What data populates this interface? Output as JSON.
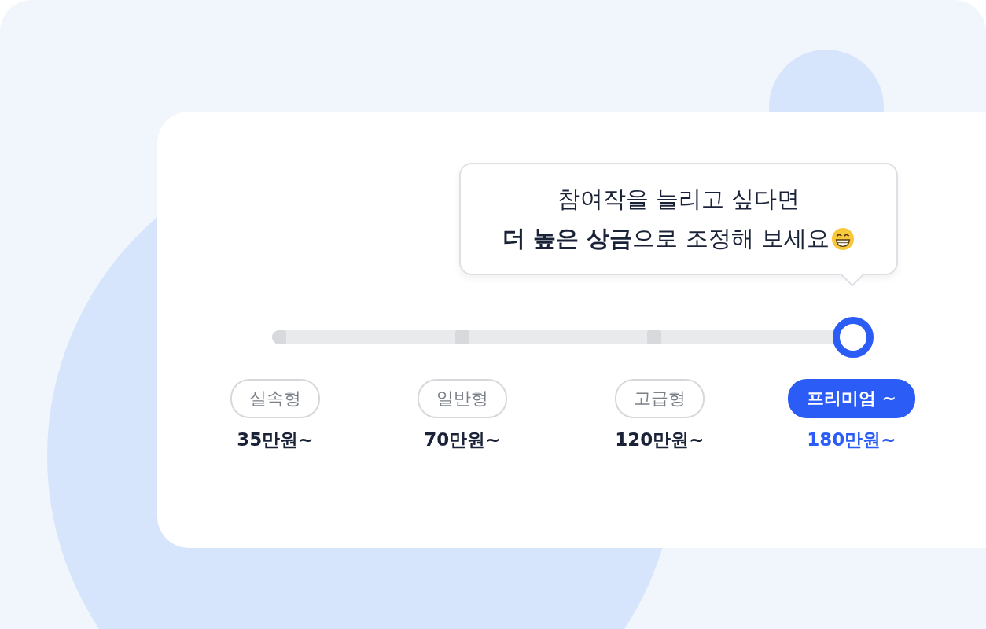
{
  "tooltip": {
    "lines": [
      "참여작을 늘리고 싶다면",
      "**더 높은 상금**으로 조정해 보세요"
    ]
  },
  "slider": {
    "level": 1
  },
  "tiers": [
    {
      "label": "실속형",
      "price": "35만원~",
      "selected": false
    },
    {
      "label": "일반형",
      "price": "70만원~",
      "selected": false
    },
    {
      "label": "고급형",
      "price": "120만원~",
      "selected": false
    },
    {
      "label": "프리미엄 ~",
      "price": "180만원~",
      "selected": true
    }
  ]
}
